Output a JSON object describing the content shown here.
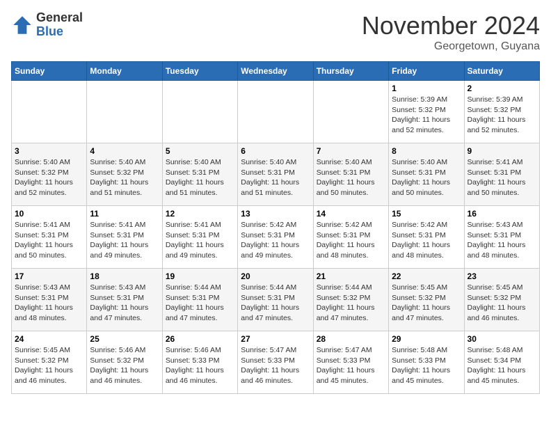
{
  "header": {
    "logo_general": "General",
    "logo_blue": "Blue",
    "month_title": "November 2024",
    "location": "Georgetown, Guyana"
  },
  "weekdays": [
    "Sunday",
    "Monday",
    "Tuesday",
    "Wednesday",
    "Thursday",
    "Friday",
    "Saturday"
  ],
  "weeks": [
    [
      {
        "day": "",
        "info": ""
      },
      {
        "day": "",
        "info": ""
      },
      {
        "day": "",
        "info": ""
      },
      {
        "day": "",
        "info": ""
      },
      {
        "day": "",
        "info": ""
      },
      {
        "day": "1",
        "info": "Sunrise: 5:39 AM\nSunset: 5:32 PM\nDaylight: 11 hours\nand 52 minutes."
      },
      {
        "day": "2",
        "info": "Sunrise: 5:39 AM\nSunset: 5:32 PM\nDaylight: 11 hours\nand 52 minutes."
      }
    ],
    [
      {
        "day": "3",
        "info": "Sunrise: 5:40 AM\nSunset: 5:32 PM\nDaylight: 11 hours\nand 52 minutes."
      },
      {
        "day": "4",
        "info": "Sunrise: 5:40 AM\nSunset: 5:32 PM\nDaylight: 11 hours\nand 51 minutes."
      },
      {
        "day": "5",
        "info": "Sunrise: 5:40 AM\nSunset: 5:31 PM\nDaylight: 11 hours\nand 51 minutes."
      },
      {
        "day": "6",
        "info": "Sunrise: 5:40 AM\nSunset: 5:31 PM\nDaylight: 11 hours\nand 51 minutes."
      },
      {
        "day": "7",
        "info": "Sunrise: 5:40 AM\nSunset: 5:31 PM\nDaylight: 11 hours\nand 50 minutes."
      },
      {
        "day": "8",
        "info": "Sunrise: 5:40 AM\nSunset: 5:31 PM\nDaylight: 11 hours\nand 50 minutes."
      },
      {
        "day": "9",
        "info": "Sunrise: 5:41 AM\nSunset: 5:31 PM\nDaylight: 11 hours\nand 50 minutes."
      }
    ],
    [
      {
        "day": "10",
        "info": "Sunrise: 5:41 AM\nSunset: 5:31 PM\nDaylight: 11 hours\nand 50 minutes."
      },
      {
        "day": "11",
        "info": "Sunrise: 5:41 AM\nSunset: 5:31 PM\nDaylight: 11 hours\nand 49 minutes."
      },
      {
        "day": "12",
        "info": "Sunrise: 5:41 AM\nSunset: 5:31 PM\nDaylight: 11 hours\nand 49 minutes."
      },
      {
        "day": "13",
        "info": "Sunrise: 5:42 AM\nSunset: 5:31 PM\nDaylight: 11 hours\nand 49 minutes."
      },
      {
        "day": "14",
        "info": "Sunrise: 5:42 AM\nSunset: 5:31 PM\nDaylight: 11 hours\nand 48 minutes."
      },
      {
        "day": "15",
        "info": "Sunrise: 5:42 AM\nSunset: 5:31 PM\nDaylight: 11 hours\nand 48 minutes."
      },
      {
        "day": "16",
        "info": "Sunrise: 5:43 AM\nSunset: 5:31 PM\nDaylight: 11 hours\nand 48 minutes."
      }
    ],
    [
      {
        "day": "17",
        "info": "Sunrise: 5:43 AM\nSunset: 5:31 PM\nDaylight: 11 hours\nand 48 minutes."
      },
      {
        "day": "18",
        "info": "Sunrise: 5:43 AM\nSunset: 5:31 PM\nDaylight: 11 hours\nand 47 minutes."
      },
      {
        "day": "19",
        "info": "Sunrise: 5:44 AM\nSunset: 5:31 PM\nDaylight: 11 hours\nand 47 minutes."
      },
      {
        "day": "20",
        "info": "Sunrise: 5:44 AM\nSunset: 5:31 PM\nDaylight: 11 hours\nand 47 minutes."
      },
      {
        "day": "21",
        "info": "Sunrise: 5:44 AM\nSunset: 5:32 PM\nDaylight: 11 hours\nand 47 minutes."
      },
      {
        "day": "22",
        "info": "Sunrise: 5:45 AM\nSunset: 5:32 PM\nDaylight: 11 hours\nand 47 minutes."
      },
      {
        "day": "23",
        "info": "Sunrise: 5:45 AM\nSunset: 5:32 PM\nDaylight: 11 hours\nand 46 minutes."
      }
    ],
    [
      {
        "day": "24",
        "info": "Sunrise: 5:45 AM\nSunset: 5:32 PM\nDaylight: 11 hours\nand 46 minutes."
      },
      {
        "day": "25",
        "info": "Sunrise: 5:46 AM\nSunset: 5:32 PM\nDaylight: 11 hours\nand 46 minutes."
      },
      {
        "day": "26",
        "info": "Sunrise: 5:46 AM\nSunset: 5:33 PM\nDaylight: 11 hours\nand 46 minutes."
      },
      {
        "day": "27",
        "info": "Sunrise: 5:47 AM\nSunset: 5:33 PM\nDaylight: 11 hours\nand 46 minutes."
      },
      {
        "day": "28",
        "info": "Sunrise: 5:47 AM\nSunset: 5:33 PM\nDaylight: 11 hours\nand 45 minutes."
      },
      {
        "day": "29",
        "info": "Sunrise: 5:48 AM\nSunset: 5:33 PM\nDaylight: 11 hours\nand 45 minutes."
      },
      {
        "day": "30",
        "info": "Sunrise: 5:48 AM\nSunset: 5:34 PM\nDaylight: 11 hours\nand 45 minutes."
      }
    ]
  ]
}
